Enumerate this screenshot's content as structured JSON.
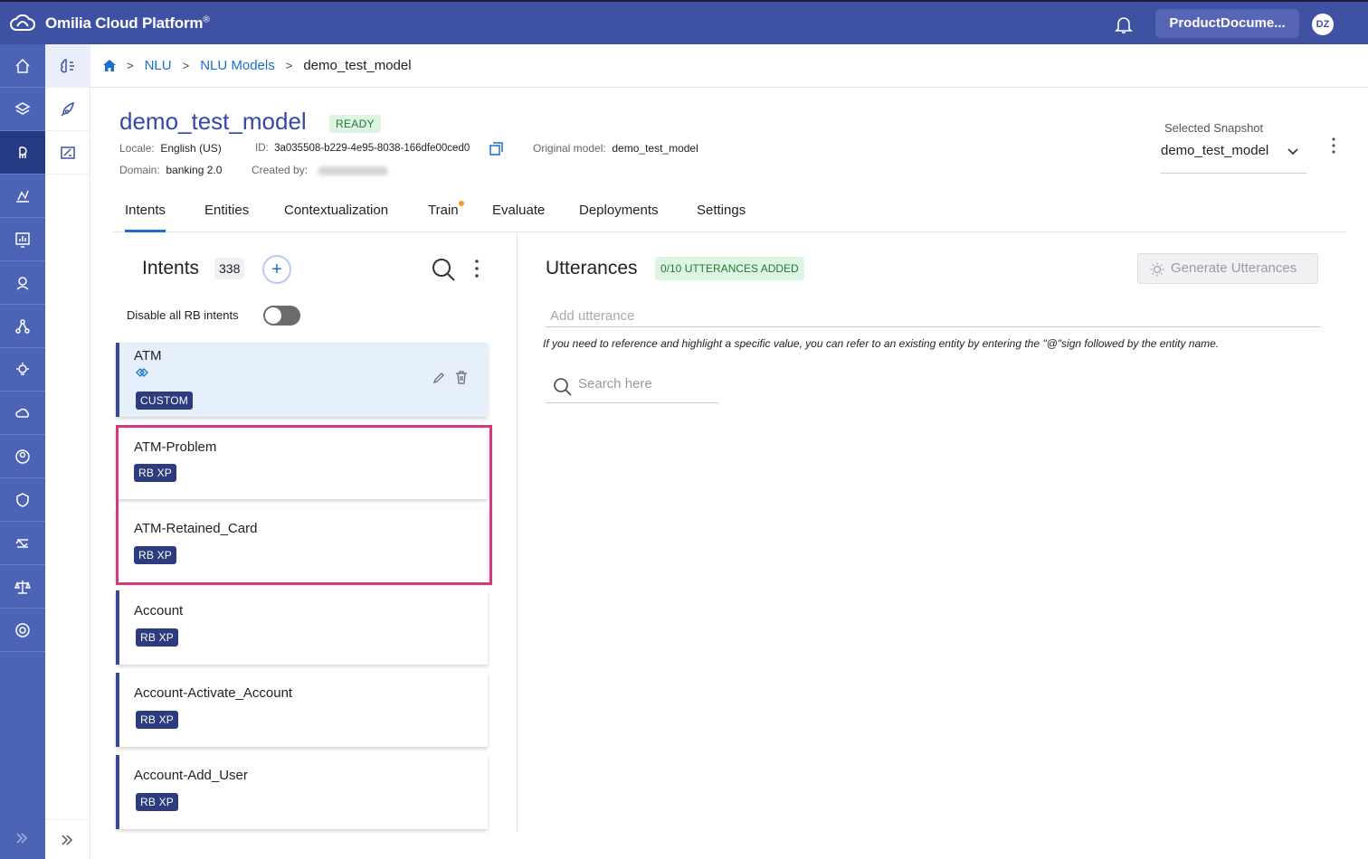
{
  "app": {
    "title": "Omilia Cloud Platform",
    "title_mark": "®",
    "account": "ProductDocume...",
    "avatar_initials": "DZ"
  },
  "breadcrumb": {
    "nlu": "NLU",
    "models": "NLU Models",
    "current": "demo_test_model"
  },
  "model": {
    "title": "demo_test_model",
    "status": "READY",
    "locale_label": "Locale:",
    "locale": "English (US)",
    "id_label": "ID:",
    "id": "3a035508-b229-4e95-8038-166dfe00ced0",
    "original_label": "Original model:",
    "original": "demo_test_model",
    "domain_label": "Domain:",
    "domain": "banking 2.0",
    "created_label": "Created by:",
    "created_by": ""
  },
  "snapshot": {
    "label": "Selected Snapshot",
    "value": "demo_test_model"
  },
  "tabs": [
    "Intents",
    "Entities",
    "Contextualization",
    "Train",
    "Evaluate",
    "Deployments",
    "Settings"
  ],
  "intents": {
    "heading": "Intents",
    "count": "338",
    "disable_label": "Disable all RB intents",
    "items": [
      {
        "name": "ATM",
        "tag": "CUSTOM"
      },
      {
        "name": "ATM-Problem",
        "tag": "RB XP"
      },
      {
        "name": "ATM-Retained_Card",
        "tag": "RB XP"
      },
      {
        "name": "Account",
        "tag": "RB XP"
      },
      {
        "name": "Account-Activate_Account",
        "tag": "RB XP"
      },
      {
        "name": "Account-Add_User",
        "tag": "RB XP"
      }
    ]
  },
  "utterances": {
    "heading": "Utterances",
    "badge": "0/10 UTTERANCES ADDED",
    "generate_label": "Generate Utterances",
    "input_placeholder": "Add utterance",
    "hint": "If you need to reference and highlight a specific value, you can refer to an existing entity by entering the \"@\"sign followed by the entity name.",
    "search_placeholder": "Search here"
  },
  "colors": {
    "brand": "#3f51a3",
    "nav": "#4d63b5",
    "link": "#1b6fd1",
    "highlight": "#d6397b",
    "ready": "#1c7a35"
  }
}
